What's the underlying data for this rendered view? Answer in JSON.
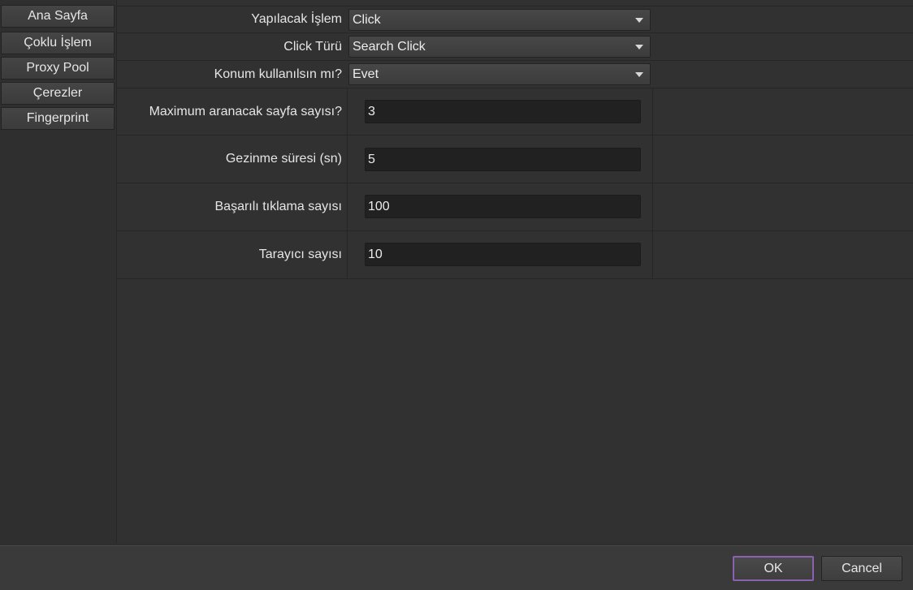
{
  "sidebar": {
    "items": [
      {
        "label": "Ana Sayfa"
      },
      {
        "label": "Çoklu İşlem"
      },
      {
        "label": "Proxy Pool"
      },
      {
        "label": "Çerezler"
      },
      {
        "label": "Fingerprint"
      }
    ]
  },
  "form": {
    "operation": {
      "label": "Yapılacak İşlem",
      "value": "Click"
    },
    "click_type": {
      "label": "Click Türü",
      "value": "Search Click"
    },
    "use_location": {
      "label": "Konum kullanılsın mı?",
      "value": "Evet"
    },
    "max_pages": {
      "label": "Maximum aranacak sayfa sayısı?",
      "value": "3"
    },
    "browse_time": {
      "label": "Gezinme süresi (sn)",
      "value": "5"
    },
    "success_clicks": {
      "label": "Başarılı tıklama sayısı",
      "value": "100"
    },
    "browser_count": {
      "label": "Tarayıcı sayısı",
      "value": "10"
    }
  },
  "buttons": {
    "ok": "OK",
    "cancel": "Cancel"
  },
  "colors": {
    "background": "#2f2f2f",
    "ok_border_accent": "#8b62b0",
    "input_background": "#212121"
  }
}
